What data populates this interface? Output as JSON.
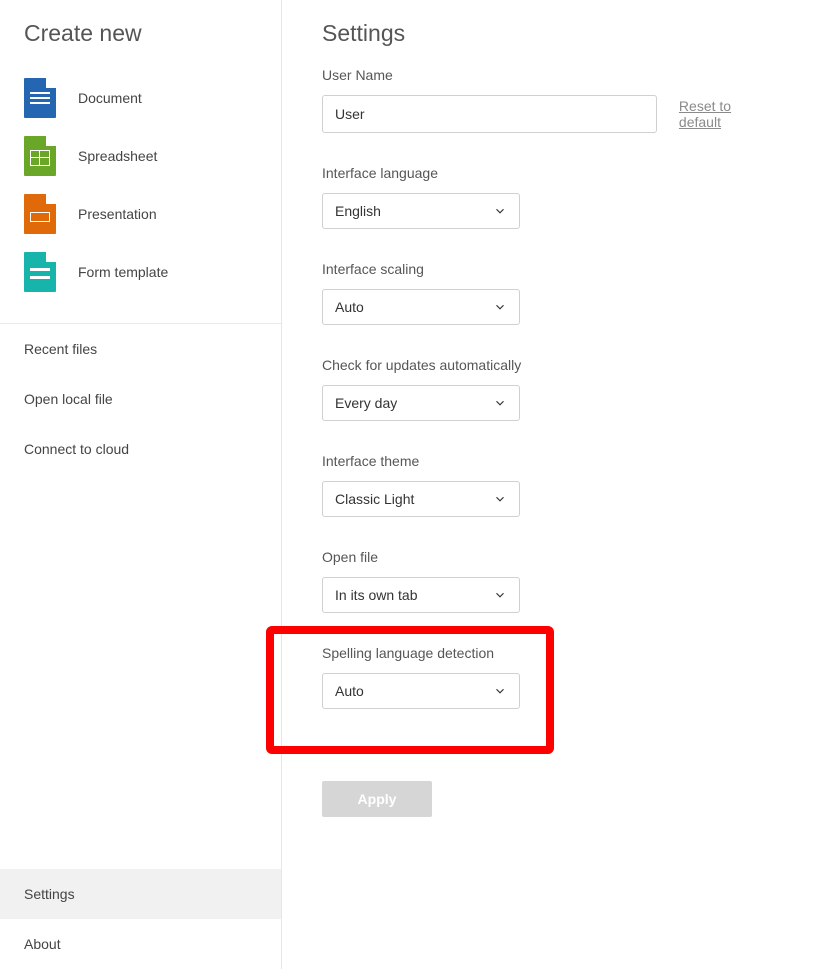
{
  "sidebar": {
    "title": "Create new",
    "create": [
      {
        "label": "Document"
      },
      {
        "label": "Spreadsheet"
      },
      {
        "label": "Presentation"
      },
      {
        "label": "Form template"
      }
    ],
    "nav": {
      "recent": "Recent files",
      "open_local": "Open local file",
      "connect": "Connect to cloud"
    },
    "bottom": {
      "settings": "Settings",
      "about": "About"
    }
  },
  "settings": {
    "title": "Settings",
    "username_label": "User Name",
    "username_value": "User",
    "reset_link": "Reset to default",
    "language_label": "Interface language",
    "language_value": "English",
    "scaling_label": "Interface scaling",
    "scaling_value": "Auto",
    "updates_label": "Check for updates automatically",
    "updates_value": "Every day",
    "theme_label": "Interface theme",
    "theme_value": "Classic Light",
    "openfile_label": "Open file",
    "openfile_value": "In its own tab",
    "spelling_label": "Spelling language detection",
    "spelling_value": "Auto",
    "apply": "Apply"
  }
}
